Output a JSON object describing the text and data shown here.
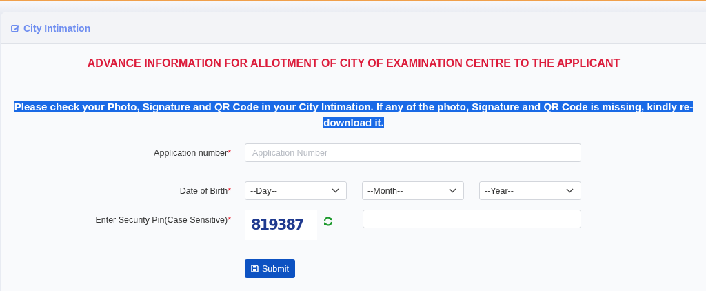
{
  "card": {
    "title": "City Intimation"
  },
  "heading": "ADVANCE INFORMATION FOR ALLOTMENT OF CITY OF EXAMINATION CENTRE TO THE APPLICANT",
  "notice_lines": [
    "Please check your Photo, Signature and QR Code in your City Intimation. If any of the photo, Signature and QR Code is missing, kindly re-",
    "download it."
  ],
  "form": {
    "application_number": {
      "label": "Application number",
      "required_mark": "*",
      "placeholder": "Application Number"
    },
    "date_of_birth": {
      "label": "Date of Birth",
      "required_mark": "*",
      "selects": [
        {
          "value": "--Day--"
        },
        {
          "value": "--Month--"
        },
        {
          "value": "--Year--"
        }
      ]
    },
    "security_pin": {
      "label": "Enter Security Pin(Case Sensitive)",
      "required_mark": "*",
      "captcha": "819387"
    },
    "submit": {
      "label": "Submit"
    }
  }
}
